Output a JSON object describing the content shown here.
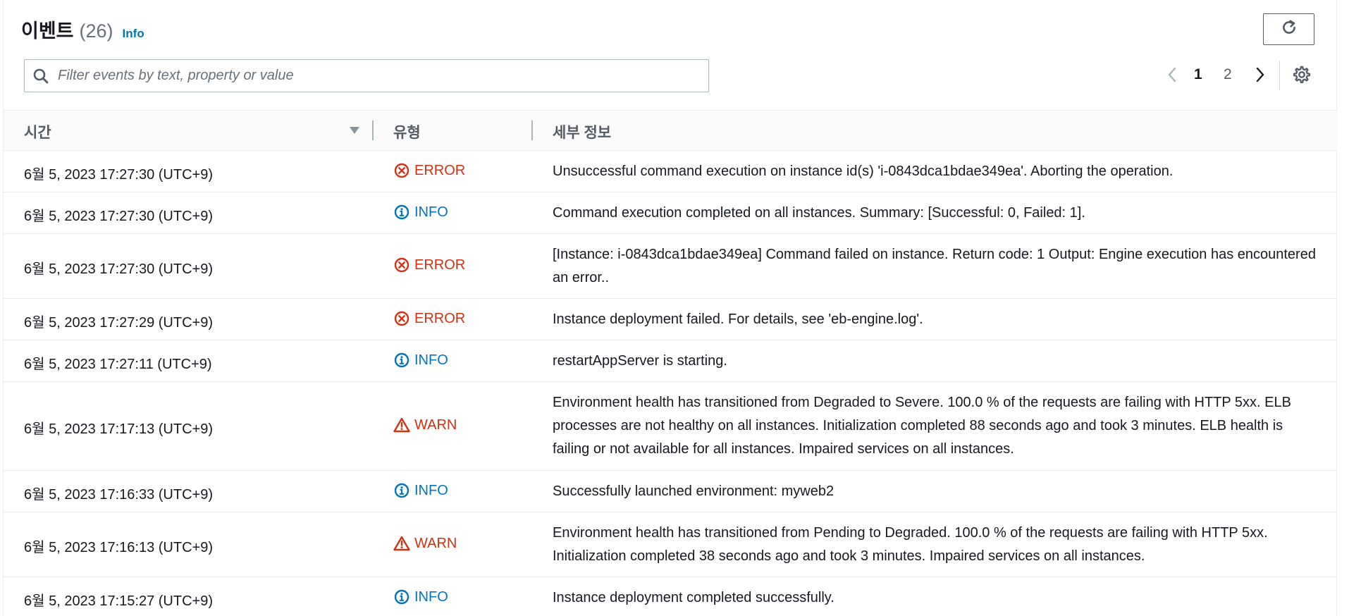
{
  "header": {
    "title": "이벤트",
    "count": "(26)",
    "info_label": "Info"
  },
  "search": {
    "placeholder": "Filter events by text, property or value",
    "value": ""
  },
  "pagination": {
    "pages": [
      "1",
      "2"
    ],
    "current": "1"
  },
  "table": {
    "columns": [
      "시간",
      "유형",
      "세부 정보"
    ],
    "rows": [
      {
        "time": "6월 5, 2023 17:27:30 (UTC+9)",
        "type": "ERROR",
        "detail": "Unsuccessful command execution on instance id(s) 'i-0843dca1bdae349ea'. Aborting the operation."
      },
      {
        "time": "6월 5, 2023 17:27:30 (UTC+9)",
        "type": "INFO",
        "detail": "Command execution completed on all instances. Summary: [Successful: 0, Failed: 1]."
      },
      {
        "time": "6월 5, 2023 17:27:30 (UTC+9)",
        "type": "ERROR",
        "detail": "[Instance: i-0843dca1bdae349ea] Command failed on instance. Return code: 1 Output: Engine execution has encountered an error.."
      },
      {
        "time": "6월 5, 2023 17:27:29 (UTC+9)",
        "type": "ERROR",
        "detail": "Instance deployment failed. For details, see 'eb-engine.log'."
      },
      {
        "time": "6월 5, 2023 17:27:11 (UTC+9)",
        "type": "INFO",
        "detail": "restartAppServer is starting."
      },
      {
        "time": "6월 5, 2023 17:17:13 (UTC+9)",
        "type": "WARN",
        "detail": "Environment health has transitioned from Degraded to Severe. 100.0 % of the requests are failing with HTTP 5xx. ELB processes are not healthy on all instances. Initialization completed 88 seconds ago and took 3 minutes. ELB health is failing or not available for all instances. Impaired services on all instances."
      },
      {
        "time": "6월 5, 2023 17:16:33 (UTC+9)",
        "type": "INFO",
        "detail": "Successfully launched environment: myweb2"
      },
      {
        "time": "6월 5, 2023 17:16:13 (UTC+9)",
        "type": "WARN",
        "detail": "Environment health has transitioned from Pending to Degraded. 100.0 % of the requests are failing with HTTP 5xx. Initialization completed 38 seconds ago and took 3 minutes. Impaired services on all instances."
      },
      {
        "time": "6월 5, 2023 17:15:27 (UTC+9)",
        "type": "INFO",
        "detail": "Instance deployment completed successfully."
      }
    ]
  },
  "icons": {
    "refresh": "refresh-icon",
    "search": "search-icon",
    "prev": "chevron-left-icon",
    "next": "chevron-right-icon",
    "settings": "gear-icon",
    "sort": "sort-down-icon",
    "error": "error-circle-icon",
    "info": "info-circle-icon",
    "warn": "warning-triangle-icon"
  },
  "colors": {
    "error": "#d13212",
    "info": "#0073bb",
    "warn": "#d13212",
    "link": "#0073bb"
  }
}
